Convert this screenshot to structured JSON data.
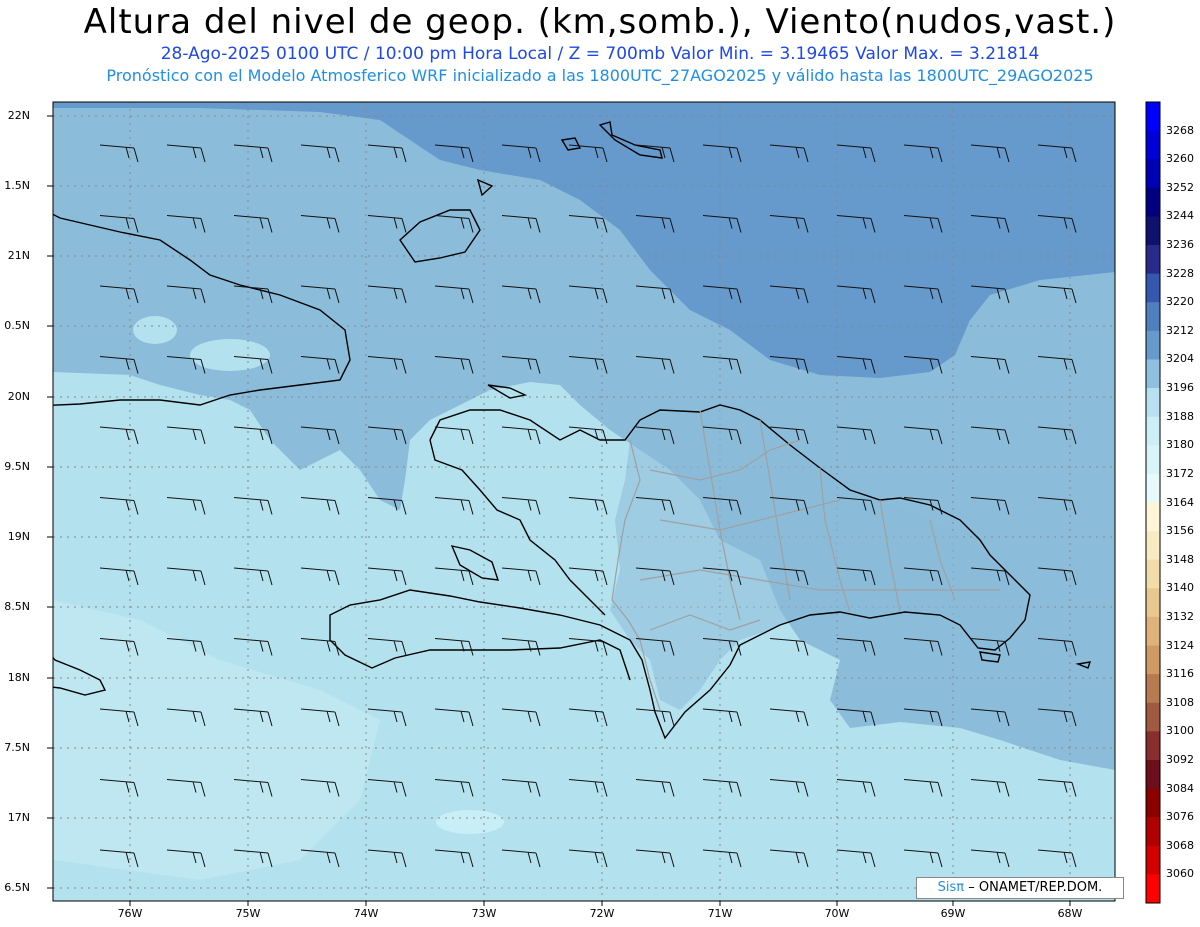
{
  "header": {
    "title": "Altura del nivel de geop. (km,somb.), Viento(nudos,vast.)",
    "subtitle1": "28-Ago-2025  0100 UTC / 10:00 pm Hora Local / Z = 700mb    Valor Min. = 3.19465  Valor Max. = 3.21814",
    "subtitle2": "Pronóstico con el Modelo Atmosferico WRF inicializado a las 1800UTC_27AGO2025 y válido hasta las  1800UTC_29AGO2025"
  },
  "axes": {
    "lat_labels": [
      "22N",
      "1.5N",
      "21N",
      "0.5N",
      "20N",
      "9.5N",
      "19N",
      "8.5N",
      "18N",
      "7.5N",
      "17N",
      "6.5N"
    ],
    "lon_labels": [
      "76W",
      "75W",
      "74W",
      "73W",
      "72W",
      "71W",
      "70W",
      "69W",
      "68W"
    ]
  },
  "colorbar": {
    "labels": [
      "3268",
      "3260",
      "3252",
      "3244",
      "3236",
      "3228",
      "3220",
      "3212",
      "3204",
      "3196",
      "3188",
      "3180",
      "3172",
      "3164",
      "3156",
      "3148",
      "3140",
      "3132",
      "3124",
      "3116",
      "3108",
      "3100",
      "3092",
      "3084",
      "3076",
      "3068",
      "3060"
    ],
    "colors": [
      "#0000ff",
      "#0000d8",
      "#0000b4",
      "#000080",
      "#10106e",
      "#2a2a8c",
      "#3557b0",
      "#4f7fbe",
      "#6699cc",
      "#8fc0e0",
      "#b8e0f0",
      "#cceef6",
      "#d8f4f8",
      "#e6fafc",
      "#fdf5d8",
      "#f8ebc4",
      "#f1dcaa",
      "#e8c890",
      "#deb27a",
      "#d09a64",
      "#b87a50",
      "#a05a40",
      "#882e2e",
      "#6e0e1a",
      "#8c0000",
      "#b00000",
      "#d40000",
      "#ff0000"
    ]
  },
  "map": {
    "field_colors": {
      "level_3220": "#5b90c4",
      "level_3212": "#8bbcda",
      "level_3204": "#b4e1ee",
      "level_3196": "#c8eef6"
    },
    "coastline_color": "#000000",
    "border_color": "#a0a0a0",
    "grid_color": "#888888"
  },
  "credit": {
    "brand": "Sisπ",
    "text": "– ONAMET/REP.DOM."
  }
}
